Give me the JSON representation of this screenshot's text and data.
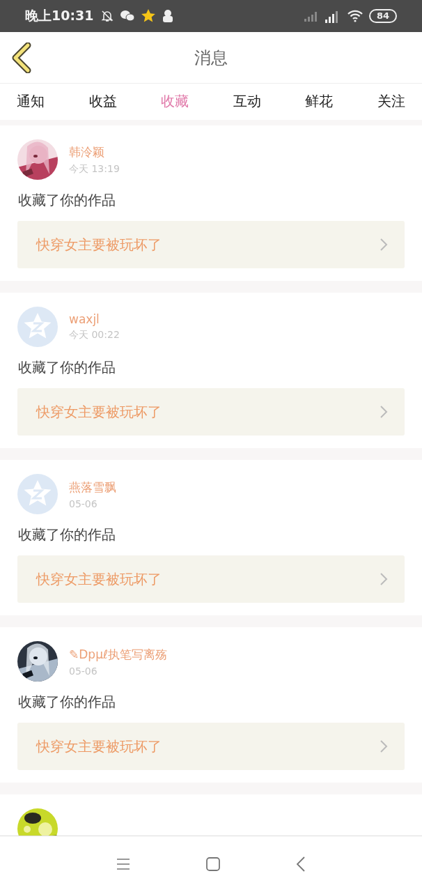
{
  "status_bar": {
    "time": "晚上10:31",
    "battery": "84"
  },
  "header": {
    "title": "消息"
  },
  "tabs": [
    {
      "label": "通知",
      "selected": false
    },
    {
      "label": "收益",
      "selected": false
    },
    {
      "label": "收藏",
      "selected": true
    },
    {
      "label": "互动",
      "selected": false
    },
    {
      "label": "鲜花",
      "selected": false
    },
    {
      "label": "关注",
      "selected": false
    }
  ],
  "messages": [
    {
      "user": "韩泠颖",
      "time": "今天 13:19",
      "action": "收藏了你的作品",
      "work": "快穿女主要被玩坏了"
    },
    {
      "user": "waxjl",
      "time": "今天 00:22",
      "avatar": {
        "kind": "default"
      },
      "action": "收藏了你的作品",
      "work": "快穿女主要被玩坏了"
    },
    {
      "user": "燕落雪飘",
      "time": "05-06",
      "avatar": {
        "kind": "default"
      },
      "action": "收藏了你的作品",
      "work": "快穿女主要被玩坏了"
    },
    {
      "user": "✎Dpμℓ执笔写离殇",
      "time": "05-06",
      "action": "收藏了你的作品",
      "work": "快穿女主要被玩坏了"
    }
  ]
}
